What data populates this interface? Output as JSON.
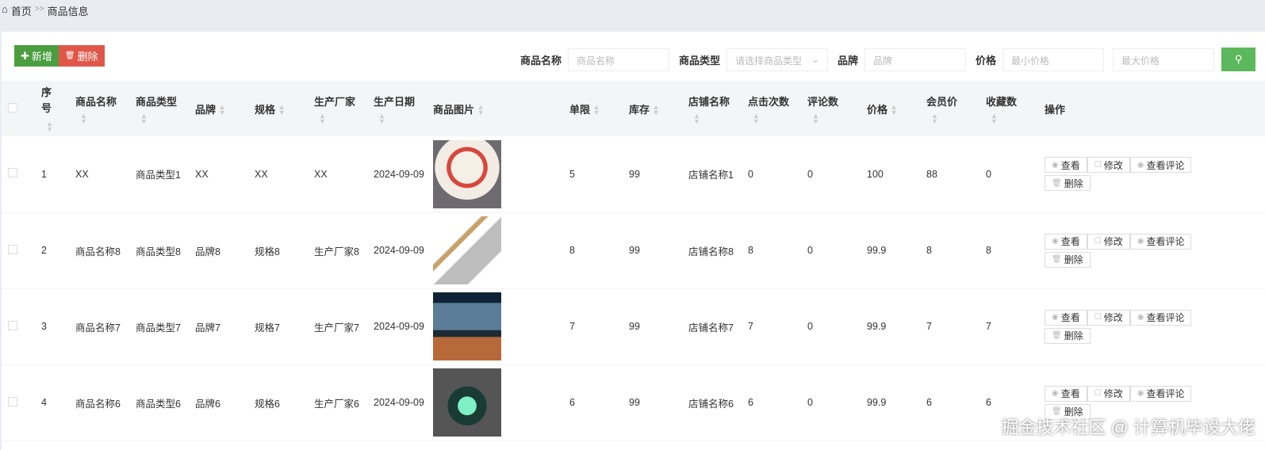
{
  "breadcrumb": {
    "home": "首页",
    "sep": ">>",
    "current": "商品信息"
  },
  "toolbar": {
    "add": "新增",
    "delete": "删除"
  },
  "search": {
    "name_label": "商品名称",
    "name_placeholder": "商品名称",
    "type_label": "商品类型",
    "type_placeholder": "请选择商品类型",
    "brand_label": "品牌",
    "brand_placeholder": "品牌",
    "price_label": "价格",
    "min_placeholder": "最小价格",
    "max_placeholder": "最大价格"
  },
  "columns": [
    "序号",
    "商品名称",
    "商品类型",
    "品牌",
    "规格",
    "生产厂家",
    "生产日期",
    "商品图片",
    "单限",
    "库存",
    "店铺名称",
    "点击次数",
    "评论数",
    "价格",
    "会员价",
    "收藏数",
    "操作"
  ],
  "actions": {
    "view": "查看",
    "edit": "修改",
    "comments": "查看评论",
    "delete": "删除"
  },
  "rows": [
    {
      "no": "1",
      "name": "XX",
      "type": "商品类型1",
      "brand": "XX",
      "spec": "XX",
      "maker": "XX",
      "date": "2024-09-09",
      "image": "cake",
      "limit": "5",
      "stock": "99",
      "shop": "店铺名称1",
      "clicks": "0",
      "reviews": "0",
      "price": "100",
      "vip": "88",
      "fav": "0"
    },
    {
      "no": "2",
      "name": "商品名称8",
      "type": "商品类型8",
      "brand": "品牌8",
      "spec": "规格8",
      "maker": "生产厂家8",
      "date": "2024-09-09",
      "image": "mop",
      "limit": "8",
      "stock": "99",
      "shop": "店铺名称8",
      "clicks": "8",
      "reviews": "0",
      "price": "99.9",
      "vip": "8",
      "fav": "8"
    },
    {
      "no": "3",
      "name": "商品名称7",
      "type": "商品类型7",
      "brand": "品牌7",
      "spec": "规格7",
      "maker": "生产厂家7",
      "date": "2024-09-09",
      "image": "monitor",
      "limit": "7",
      "stock": "99",
      "shop": "店铺名称7",
      "clicks": "7",
      "reviews": "0",
      "price": "99.9",
      "vip": "7",
      "fav": "7"
    },
    {
      "no": "4",
      "name": "商品名称6",
      "type": "商品类型6",
      "brand": "品牌6",
      "spec": "规格6",
      "maker": "生产厂家6",
      "date": "2024-09-09",
      "image": "clock",
      "limit": "6",
      "stock": "99",
      "shop": "店铺名称6",
      "clicks": "6",
      "reviews": "0",
      "price": "99.9",
      "vip": "6",
      "fav": "6"
    }
  ],
  "watermark": "掘金技术社区 @ 计算机毕设大佬"
}
